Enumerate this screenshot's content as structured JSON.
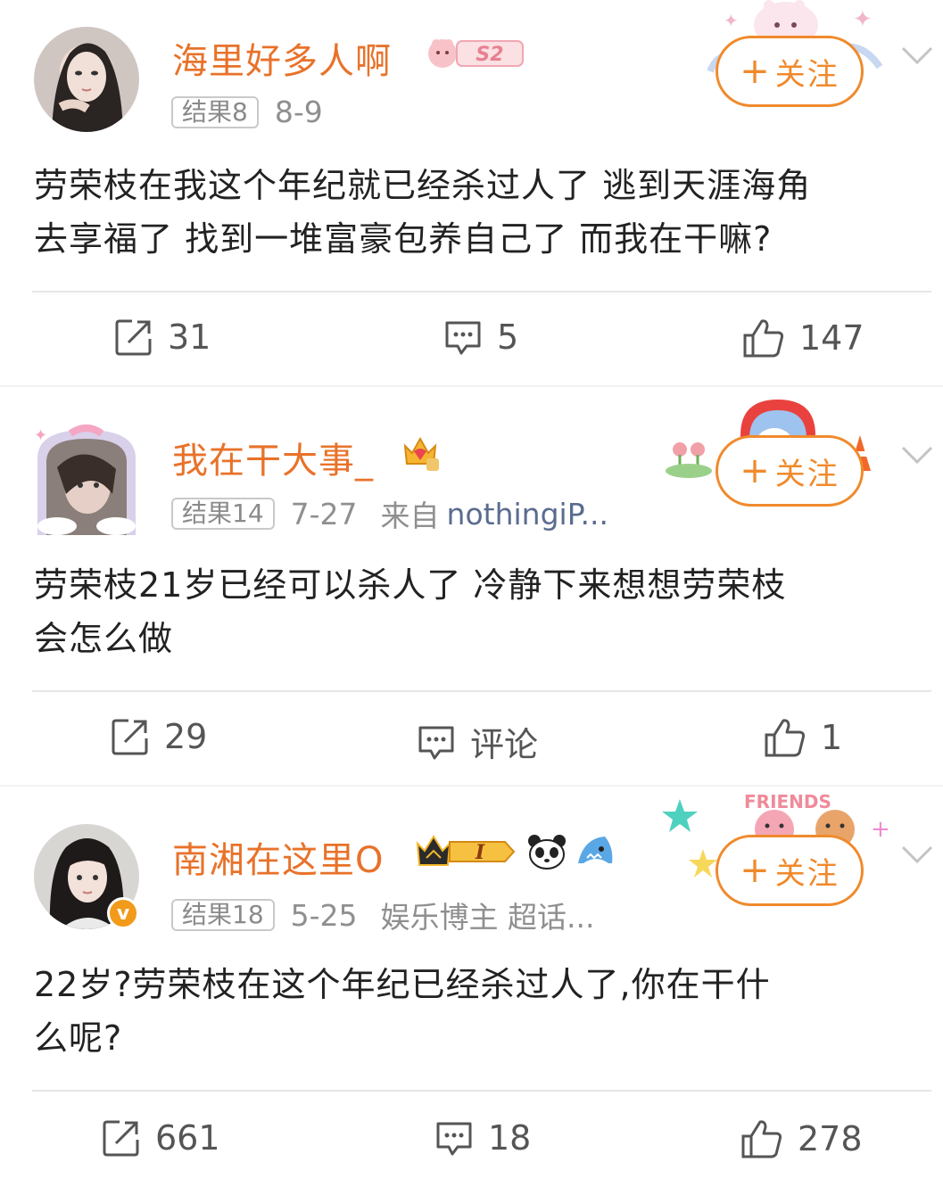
{
  "posts": [
    {
      "username": "海里好多人啊",
      "tag": "结果8",
      "date": "8-9",
      "source": "",
      "follow_label": "关注",
      "badge_text": "S2",
      "text_lines": [
        "劳荣枝在我这个年纪就已经杀过人了 逃到天涯海角",
        "去享福了 找到一堆富豪包养自己了 而我在干嘛?"
      ],
      "actions": {
        "repost": "31",
        "comment": "5",
        "like": "147"
      }
    },
    {
      "username": "我在干大事_",
      "tag": "结果14",
      "date": "7-27",
      "source_prefix": "来自",
      "source": "nothingiP...",
      "follow_label": "关注",
      "text_lines": [
        "劳荣枝21岁已经可以杀人了 冷静下来想想劳荣枝",
        "会怎么做"
      ],
      "actions": {
        "repost": "29",
        "comment": "评论",
        "like": "1"
      }
    },
    {
      "username": "南湘在这里O",
      "tag": "结果18",
      "date": "5-25",
      "source": "娱乐博主 超话...",
      "follow_label": "关注",
      "badge_text": "I",
      "verified": "v",
      "deco_text": "FRIENDS",
      "text_lines": [
        "22岁?劳荣枝在这个年纪已经杀过人了,你在干什",
        "么呢?"
      ],
      "actions": {
        "repost": "661",
        "comment": "18",
        "like": "278"
      }
    }
  ],
  "colors": {
    "accent": "#f08a2c",
    "name": "#e8722a",
    "meta": "#8f8f8f",
    "source": "#5a6c8f"
  },
  "icons": [
    "repost-icon",
    "comment-icon",
    "like-icon",
    "chevron-down-icon"
  ]
}
